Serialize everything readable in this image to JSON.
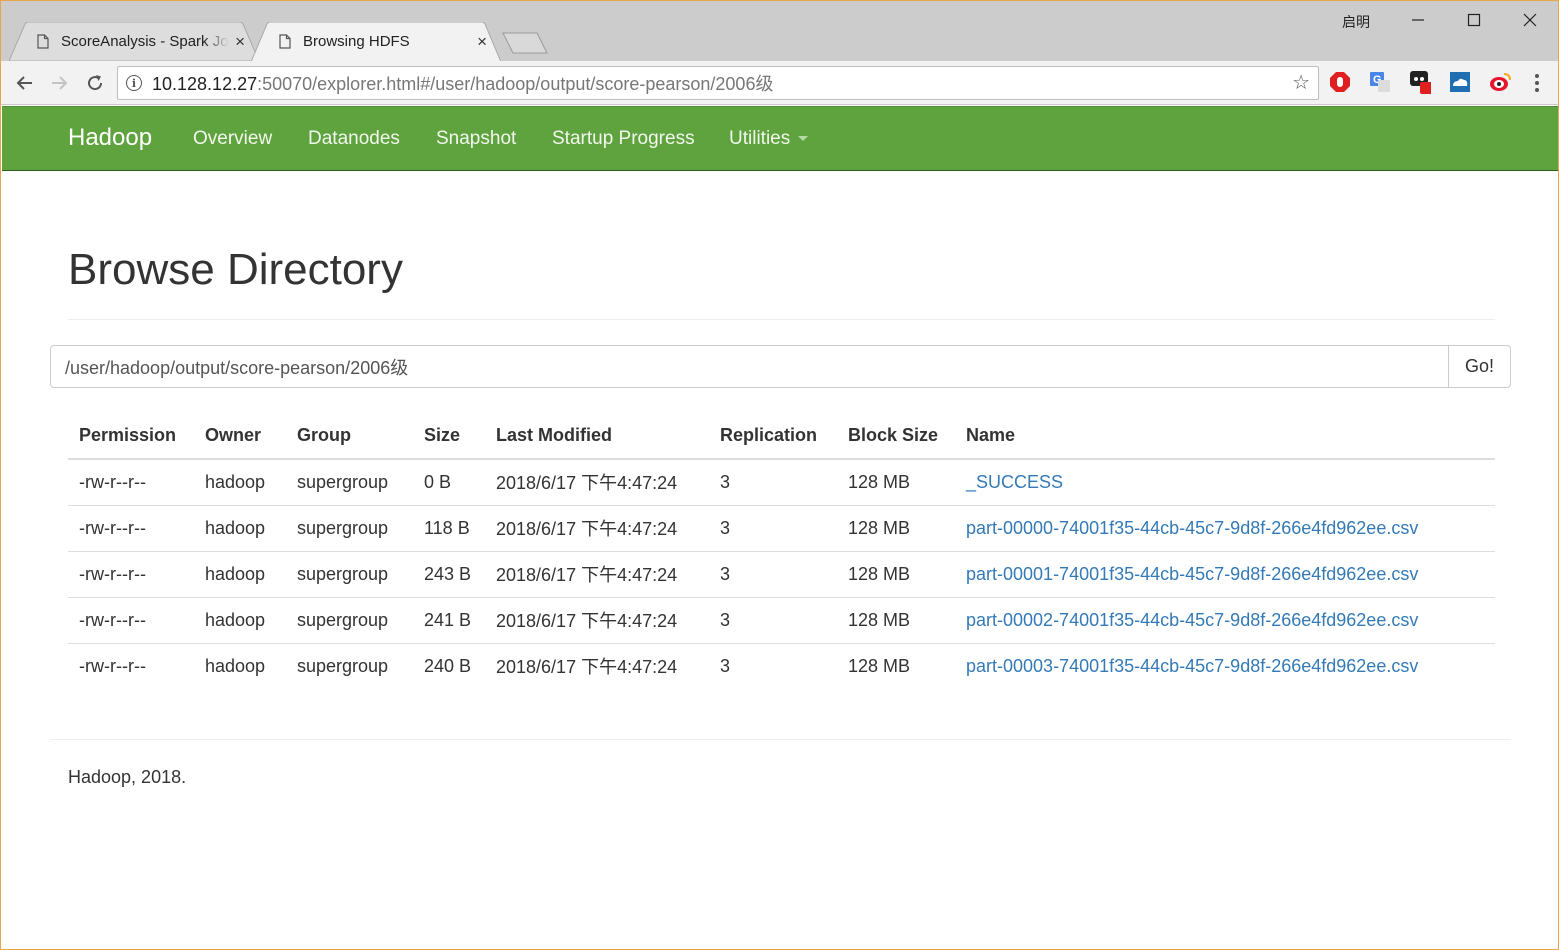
{
  "browser": {
    "tabs": [
      {
        "title": "ScoreAnalysis - Spark Jobs",
        "close": "×"
      },
      {
        "title": "Browsing HDFS",
        "close": "×"
      }
    ],
    "user": "启明",
    "url": {
      "host": "10.128.12.27",
      "rest": ":50070/explorer.html#/user/hadoop/output/score-pearson/2006级"
    },
    "info_glyph": "i",
    "star_glyph": "☆",
    "extensions": [
      {
        "icon": "adblock-icon"
      },
      {
        "icon": "google-translate-icon"
      },
      {
        "icon": "extension-badge-icon",
        "badge": "1"
      },
      {
        "icon": "cloud-extension-icon"
      },
      {
        "icon": "weibo-icon"
      }
    ]
  },
  "navbar": {
    "brand": "Hadoop",
    "links": [
      "Overview",
      "Datanodes",
      "Snapshot",
      "Startup Progress",
      "Utilities"
    ],
    "background": "#5fa33e"
  },
  "page": {
    "title": "Browse Directory",
    "path_value": "/user/hadoop/output/score-pearson/2006级",
    "go_label": "Go!"
  },
  "table": {
    "headers": [
      "Permission",
      "Owner",
      "Group",
      "Size",
      "Last Modified",
      "Replication",
      "Block Size",
      "Name"
    ],
    "rows": [
      [
        "-rw-r--r--",
        "hadoop",
        "supergroup",
        "0 B",
        "2018/6/17 下午4:47:24",
        "3",
        "128 MB",
        "_SUCCESS"
      ],
      [
        "-rw-r--r--",
        "hadoop",
        "supergroup",
        "118 B",
        "2018/6/17 下午4:47:24",
        "3",
        "128 MB",
        "part-00000-74001f35-44cb-45c7-9d8f-266e4fd962ee.csv"
      ],
      [
        "-rw-r--r--",
        "hadoop",
        "supergroup",
        "243 B",
        "2018/6/17 下午4:47:24",
        "3",
        "128 MB",
        "part-00001-74001f35-44cb-45c7-9d8f-266e4fd962ee.csv"
      ],
      [
        "-rw-r--r--",
        "hadoop",
        "supergroup",
        "241 B",
        "2018/6/17 下午4:47:24",
        "3",
        "128 MB",
        "part-00002-74001f35-44cb-45c7-9d8f-266e4fd962ee.csv"
      ],
      [
        "-rw-r--r--",
        "hadoop",
        "supergroup",
        "240 B",
        "2018/6/17 下午4:47:24",
        "3",
        "128 MB",
        "part-00003-74001f35-44cb-45c7-9d8f-266e4fd962ee.csv"
      ]
    ],
    "link_color": "#337ab7"
  },
  "footer": {
    "text": "Hadoop, 2018."
  }
}
